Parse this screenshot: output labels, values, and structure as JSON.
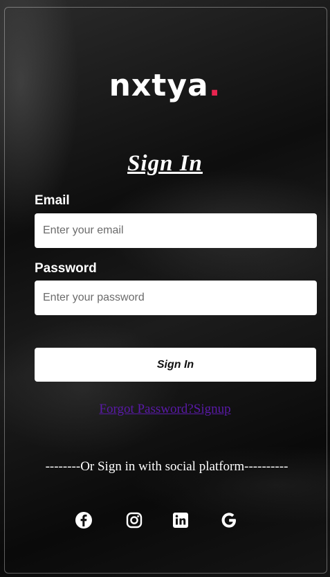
{
  "brand": {
    "logo_text": "nxty",
    "logo_last": "a",
    "logo_dot": ".",
    "accent_color": "#e8244f"
  },
  "form": {
    "title": "Sign In",
    "email_label": "Email",
    "email_placeholder": "Enter your email",
    "email_value": "",
    "password_label": "Password",
    "password_placeholder": "Enter your password",
    "password_value": "",
    "submit_label": "Sign In"
  },
  "links": {
    "forgot_password": "Forgot Password?",
    "signup": "Signup",
    "link_color": "#5a1aa8"
  },
  "social": {
    "divider_text": "--------Or Sign in with social platform----------",
    "icons": [
      "facebook-icon",
      "instagram-icon",
      "linkedin-icon",
      "google-icon"
    ]
  }
}
